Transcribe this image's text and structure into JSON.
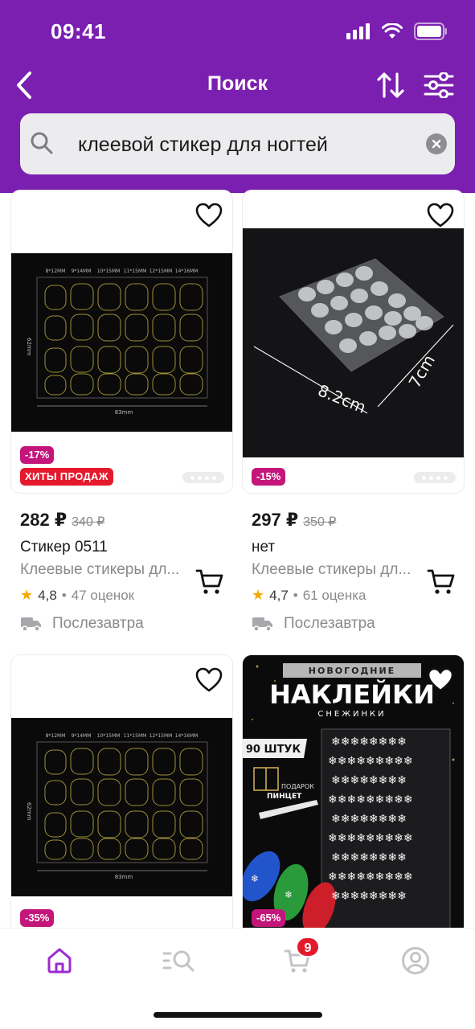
{
  "status_bar": {
    "time": "09:41"
  },
  "nav": {
    "title": "Поиск"
  },
  "search": {
    "query": "клеевой стикер для ногтей"
  },
  "products": [
    {
      "discount": "-17%",
      "hit_label": "ХИТЫ ПРОДАЖ",
      "price": "282 ₽",
      "old_price": "340 ₽",
      "title": "Стикер 0511",
      "subtitle": "Клеевые стикеры дл...",
      "rating": "4,8",
      "reviews": "47 оценок",
      "delivery": "Послезавтра",
      "image": {
        "sizes": [
          "8*12MM",
          "9*14MM",
          "10*15MM",
          "11*15MM",
          "12*15MM",
          "14*16MM"
        ],
        "side_label": "62mm",
        "bottom_label": "83mm"
      }
    },
    {
      "discount": "-15%",
      "price": "297 ₽",
      "old_price": "350 ₽",
      "title": "нет",
      "subtitle": "Клеевые стикеры дл...",
      "rating": "4,7",
      "reviews": "61 оценка",
      "delivery": "Послезавтра",
      "image": {
        "width_label": "8.2cm",
        "height_label": "7cm"
      }
    },
    {
      "discount": "-35%",
      "image": {
        "sizes": [
          "8*12MM",
          "9*14MM",
          "10*15MM",
          "11*15MM",
          "12*15MM",
          "14*16MM"
        ],
        "side_label": "62mm",
        "bottom_label": "83mm"
      }
    },
    {
      "discount": "-65%",
      "image": {
        "top_banner": "НОВОГОДНИЕ",
        "headline": "НАКЛЕЙКИ",
        "subline": "СНЕЖИНКИ",
        "count_label": "90 ШТУК",
        "gift_label": "ПОДАРОК",
        "gift_item": "ПИНЦЕТ"
      }
    }
  ],
  "tabbar": {
    "cart_count": "9"
  },
  "colors": {
    "brand": "#7b1fb0",
    "discount": "#c4157a",
    "hit": "#e5192c",
    "star": "#f6a800"
  },
  "icons": [
    "back-icon",
    "sort-icon",
    "filter-icon",
    "search-icon",
    "clear-icon",
    "heart-icon",
    "cart-icon",
    "truck-icon",
    "home-icon",
    "catalog-search-icon",
    "basket-icon",
    "profile-icon"
  ]
}
